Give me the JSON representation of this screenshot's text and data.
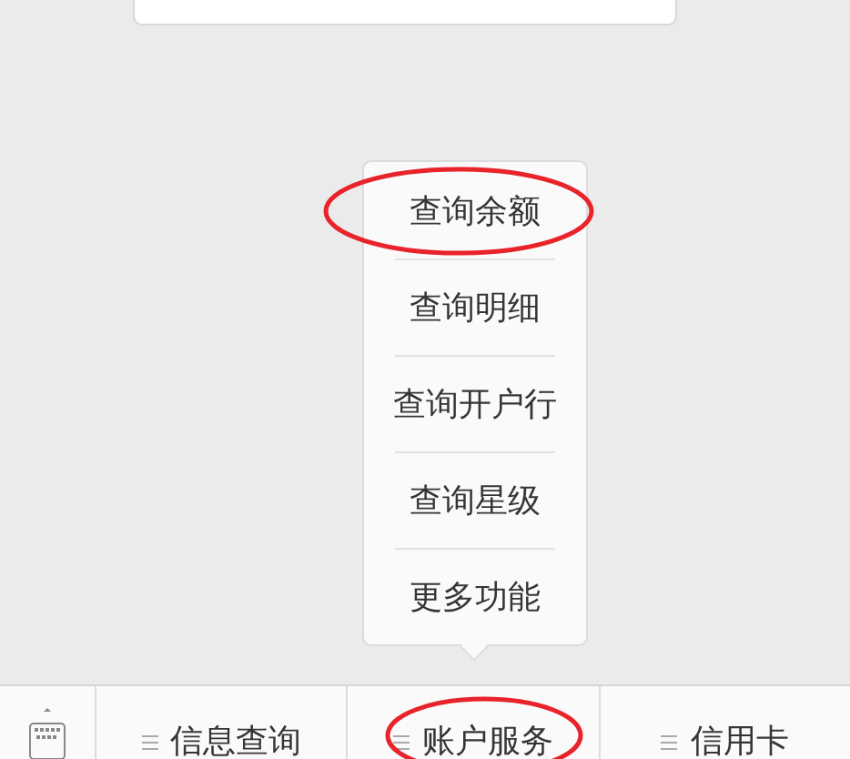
{
  "popup_menu": {
    "items": [
      {
        "label": "查询余额",
        "circled": true
      },
      {
        "label": "查询明细",
        "circled": false
      },
      {
        "label": "查询开户行",
        "circled": false
      },
      {
        "label": "查询星级",
        "circled": false
      },
      {
        "label": "更多功能",
        "circled": false
      }
    ]
  },
  "menu_bar": {
    "tabs": [
      {
        "label": "信息查询",
        "circled": false
      },
      {
        "label": "账户服务",
        "circled": true
      },
      {
        "label": "信用卡",
        "circled": false
      }
    ]
  }
}
